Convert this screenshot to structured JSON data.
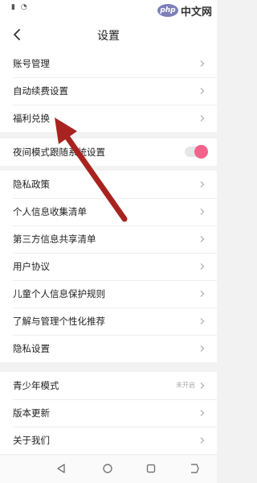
{
  "watermark": {
    "badge": "php",
    "text": "中文网"
  },
  "header": {
    "title": "设置"
  },
  "groups": {
    "account": [
      {
        "label": "账号管理"
      },
      {
        "label": "自动续费设置"
      },
      {
        "label": "福利兑换"
      }
    ],
    "display": [
      {
        "label": "夜间模式跟随系统设置",
        "toggle_on": true
      }
    ],
    "privacy": [
      {
        "label": "隐私政策"
      },
      {
        "label": "个人信息收集清单"
      },
      {
        "label": "第三方信息共享清单"
      },
      {
        "label": "用户协议"
      },
      {
        "label": "儿童个人信息保护规则"
      },
      {
        "label": "了解与管理个性化推荐"
      },
      {
        "label": "隐私设置"
      }
    ],
    "other": [
      {
        "label": "青少年模式",
        "value": "未开启"
      },
      {
        "label": "版本更新"
      },
      {
        "label": "关于我们"
      }
    ]
  },
  "icons": {
    "back": "chevron-left-icon",
    "row_arrow": "chevron-right-icon",
    "nav_back": "triangle-back-icon",
    "nav_home": "circle-home-icon",
    "nav_recents": "square-recents-icon",
    "nav_menu": "menu-icon"
  },
  "colors": {
    "toggle_accent": "#f2638b",
    "annotation_arrow": "#a8231f",
    "background": "#f2f2f2"
  }
}
